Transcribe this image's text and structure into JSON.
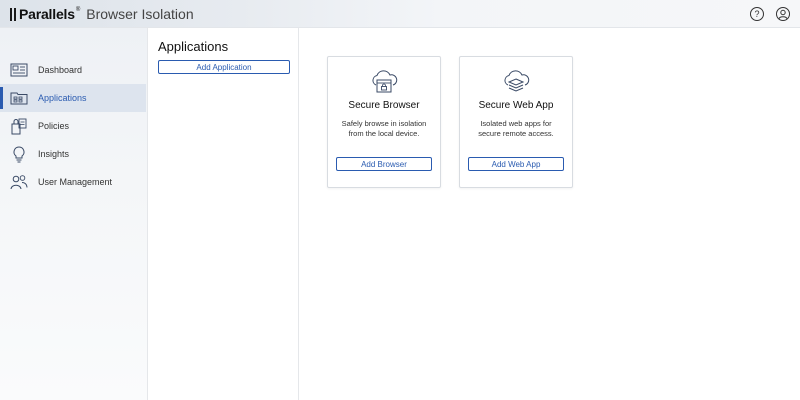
{
  "header": {
    "brand_name": "Parallels",
    "brand_mark": "®",
    "product_name": "Browser Isolation",
    "help_glyph": "?",
    "help_icon": "help-circle-icon",
    "user_icon": "user-circle-icon"
  },
  "sidebar": {
    "items": [
      {
        "label": "Dashboard",
        "icon": "dashboard-icon",
        "active": false
      },
      {
        "label": "Applications",
        "icon": "applications-icon",
        "active": true
      },
      {
        "label": "Policies",
        "icon": "policies-icon",
        "active": false
      },
      {
        "label": "Insights",
        "icon": "lightbulb-icon",
        "active": false
      },
      {
        "label": "User Management",
        "icon": "users-icon",
        "active": false
      }
    ]
  },
  "applications": {
    "title": "Applications",
    "add_button": "Add Application"
  },
  "cards": [
    {
      "title": "Secure Browser",
      "desc_line1": "Safely browse in isolation",
      "desc_line2": "from the local device.",
      "button": "Add Browser",
      "icon": "cloud-browser-icon"
    },
    {
      "title": "Secure Web App",
      "desc_line1": "Isolated web apps for",
      "desc_line2": "secure remote access.",
      "button": "Add Web App",
      "icon": "cloud-stack-icon"
    }
  ],
  "colors": {
    "accent": "#2a5bb0",
    "active_bg": "#dde4ee"
  }
}
